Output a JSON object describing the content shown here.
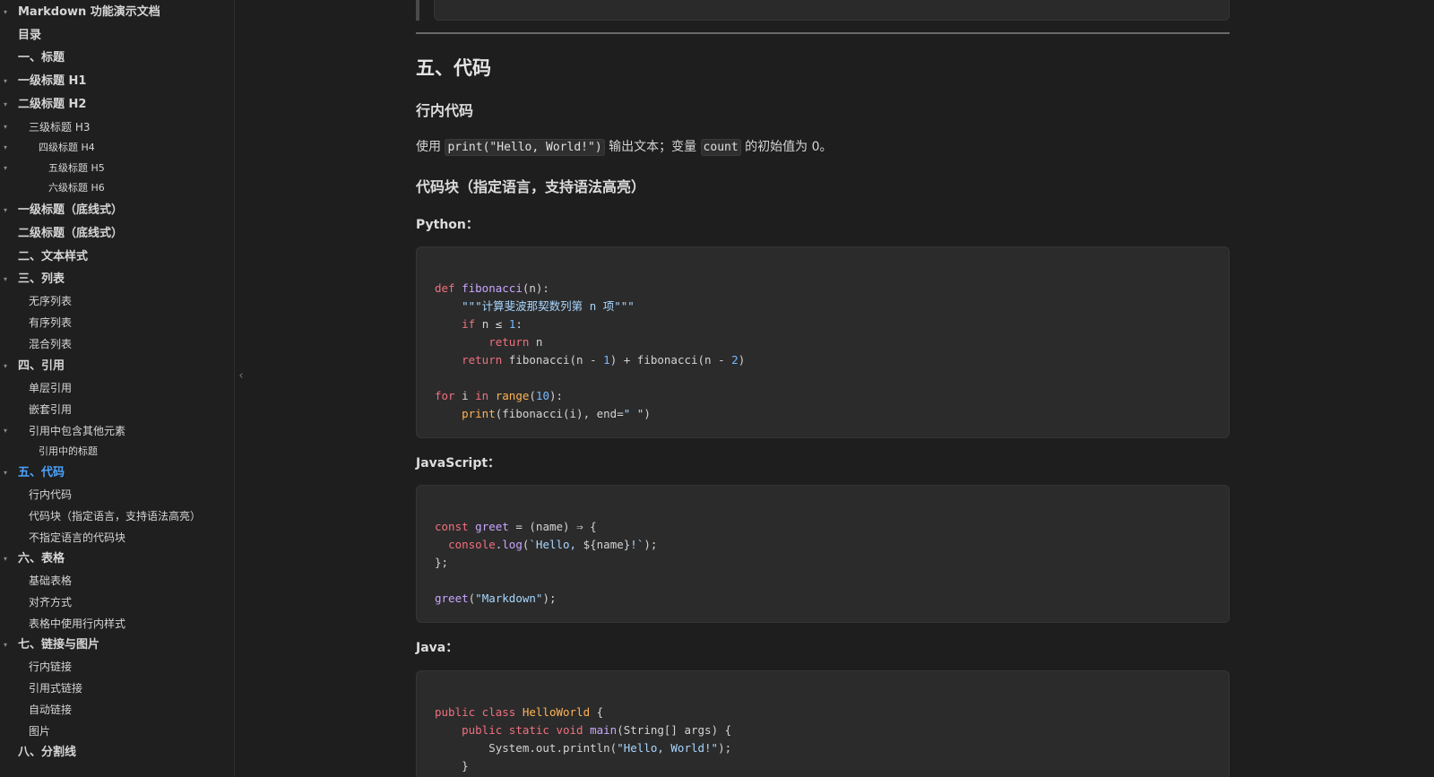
{
  "sidebar": {
    "items": [
      {
        "label": "Markdown 功能演示文档",
        "level": 1,
        "arrow": true,
        "active": false
      },
      {
        "label": "目录",
        "level": 1,
        "arrow": false,
        "active": false
      },
      {
        "label": "一、标题",
        "level": 1,
        "arrow": false,
        "active": false
      },
      {
        "label": "一级标题 H1",
        "level": 1,
        "arrow": true,
        "active": false
      },
      {
        "label": "二级标题 H2",
        "level": 1,
        "arrow": true,
        "active": false
      },
      {
        "label": "三级标题 H3",
        "level": 2,
        "arrow": true,
        "active": false
      },
      {
        "label": "四级标题 H4",
        "level": 3,
        "arrow": true,
        "active": false
      },
      {
        "label": "五级标题 H5",
        "level": 4,
        "arrow": true,
        "active": false
      },
      {
        "label": "六级标题 H6",
        "level": 4,
        "arrow": false,
        "active": false
      },
      {
        "label": "一级标题（底线式）",
        "level": 1,
        "arrow": true,
        "active": false
      },
      {
        "label": "二级标题（底线式）",
        "level": 1,
        "arrow": false,
        "active": false
      },
      {
        "label": "二、文本样式",
        "level": 1,
        "arrow": false,
        "active": false
      },
      {
        "label": "三、列表",
        "level": 1,
        "arrow": true,
        "active": false
      },
      {
        "label": "无序列表",
        "level": 2,
        "arrow": false,
        "active": false
      },
      {
        "label": "有序列表",
        "level": 2,
        "arrow": false,
        "active": false
      },
      {
        "label": "混合列表",
        "level": 2,
        "arrow": false,
        "active": false
      },
      {
        "label": "四、引用",
        "level": 1,
        "arrow": true,
        "active": false
      },
      {
        "label": "单层引用",
        "level": 2,
        "arrow": false,
        "active": false
      },
      {
        "label": "嵌套引用",
        "level": 2,
        "arrow": false,
        "active": false
      },
      {
        "label": "引用中包含其他元素",
        "level": 2,
        "arrow": true,
        "active": false
      },
      {
        "label": "引用中的标题",
        "level": 3,
        "arrow": false,
        "active": false
      },
      {
        "label": "五、代码",
        "level": 1,
        "arrow": true,
        "active": true
      },
      {
        "label": "行内代码",
        "level": 2,
        "arrow": false,
        "active": false
      },
      {
        "label": "代码块（指定语言，支持语法高亮）",
        "level": 2,
        "arrow": false,
        "active": false
      },
      {
        "label": "不指定语言的代码块",
        "level": 2,
        "arrow": false,
        "active": false
      },
      {
        "label": "六、表格",
        "level": 1,
        "arrow": true,
        "active": false
      },
      {
        "label": "基础表格",
        "level": 2,
        "arrow": false,
        "active": false
      },
      {
        "label": "对齐方式",
        "level": 2,
        "arrow": false,
        "active": false
      },
      {
        "label": "表格中使用行内样式",
        "level": 2,
        "arrow": false,
        "active": false
      },
      {
        "label": "七、链接与图片",
        "level": 1,
        "arrow": true,
        "active": false
      },
      {
        "label": "行内链接",
        "level": 2,
        "arrow": false,
        "active": false
      },
      {
        "label": "引用式链接",
        "level": 2,
        "arrow": false,
        "active": false
      },
      {
        "label": "自动链接",
        "level": 2,
        "arrow": false,
        "active": false
      },
      {
        "label": "图片",
        "level": 2,
        "arrow": false,
        "active": false
      },
      {
        "label": "八、分割线",
        "level": 1,
        "arrow": false,
        "active": false
      }
    ],
    "collapse_glyph": "‹",
    "arrow_glyph": "▾"
  },
  "content": {
    "section_title": "五、代码",
    "inline_code": {
      "heading": "行内代码",
      "text_before": "使用",
      "code1": "print(\"Hello, World!\")",
      "text_middle": "输出文本；变量",
      "code2": "count",
      "text_after": "的初始值为 0。"
    },
    "code_blocks_heading": "代码块（指定语言，支持语法高亮）",
    "python": {
      "label": "Python：",
      "lines": [
        [],
        [
          {
            "t": "def ",
            "c": "kw"
          },
          {
            "t": "fibonacci",
            "c": "fn"
          },
          {
            "t": "(n):",
            "c": "plain"
          }
        ],
        [
          {
            "t": "    \"\"\"计算斐波那契数列第 n 项\"\"\"",
            "c": "str"
          }
        ],
        [
          {
            "t": "    ",
            "c": "plain"
          },
          {
            "t": "if",
            "c": "kw"
          },
          {
            "t": " n ≤ ",
            "c": "plain"
          },
          {
            "t": "1",
            "c": "num"
          },
          {
            "t": ":",
            "c": "plain"
          }
        ],
        [
          {
            "t": "        ",
            "c": "plain"
          },
          {
            "t": "return",
            "c": "kw"
          },
          {
            "t": " n",
            "c": "plain"
          }
        ],
        [
          {
            "t": "    ",
            "c": "plain"
          },
          {
            "t": "return",
            "c": "kw"
          },
          {
            "t": " fibonacci(n - ",
            "c": "plain"
          },
          {
            "t": "1",
            "c": "num"
          },
          {
            "t": ") + fibonacci(n - ",
            "c": "plain"
          },
          {
            "t": "2",
            "c": "num"
          },
          {
            "t": ")",
            "c": "plain"
          }
        ],
        [],
        [
          {
            "t": "for",
            "c": "kw"
          },
          {
            "t": " i ",
            "c": "plain"
          },
          {
            "t": "in",
            "c": "kw"
          },
          {
            "t": " ",
            "c": "plain"
          },
          {
            "t": "range",
            "c": "bi"
          },
          {
            "t": "(",
            "c": "plain"
          },
          {
            "t": "10",
            "c": "num"
          },
          {
            "t": "):",
            "c": "plain"
          }
        ],
        [
          {
            "t": "    ",
            "c": "plain"
          },
          {
            "t": "print",
            "c": "bi"
          },
          {
            "t": "(fibonacci(i), end=",
            "c": "plain"
          },
          {
            "t": "\" \"",
            "c": "str"
          },
          {
            "t": ")",
            "c": "plain"
          }
        ]
      ]
    },
    "javascript": {
      "label": "JavaScript：",
      "lines": [
        [],
        [
          {
            "t": "const",
            "c": "kw"
          },
          {
            "t": " ",
            "c": "plain"
          },
          {
            "t": "greet",
            "c": "fn"
          },
          {
            "t": " = (name) ⇒ {",
            "c": "plain"
          }
        ],
        [
          {
            "t": "  ",
            "c": "plain"
          },
          {
            "t": "console",
            "c": "kw"
          },
          {
            "t": ".",
            "c": "plain"
          },
          {
            "t": "log",
            "c": "fn"
          },
          {
            "t": "(",
            "c": "plain"
          },
          {
            "t": "`Hello, ",
            "c": "str"
          },
          {
            "t": "${name}",
            "c": "plain"
          },
          {
            "t": "!`",
            "c": "str"
          },
          {
            "t": ");",
            "c": "plain"
          }
        ],
        [
          {
            "t": "};",
            "c": "plain"
          }
        ],
        [],
        [
          {
            "t": "greet",
            "c": "fn"
          },
          {
            "t": "(",
            "c": "plain"
          },
          {
            "t": "\"Markdown\"",
            "c": "str"
          },
          {
            "t": ");",
            "c": "plain"
          }
        ]
      ]
    },
    "java": {
      "label": "Java：",
      "lines": [
        [],
        [
          {
            "t": "public class ",
            "c": "kw"
          },
          {
            "t": "HelloWorld",
            "c": "bi"
          },
          {
            "t": " {",
            "c": "plain"
          }
        ],
        [
          {
            "t": "    ",
            "c": "plain"
          },
          {
            "t": "public static void ",
            "c": "kw"
          },
          {
            "t": "main",
            "c": "fn"
          },
          {
            "t": "(String[] args) {",
            "c": "plain"
          }
        ],
        [
          {
            "t": "        System.out.println(",
            "c": "plain"
          },
          {
            "t": "\"Hello, World!\"",
            "c": "str"
          },
          {
            "t": ");",
            "c": "plain"
          }
        ],
        [
          {
            "t": "    }",
            "c": "plain"
          }
        ]
      ]
    }
  },
  "colors": {
    "background": "#1e1e1e",
    "active_outline": "#4aa3ff",
    "keyword": "#f0707e",
    "function": "#c9a6ff",
    "string": "#a8d6ff",
    "number": "#79b8ff",
    "builtin": "#ffb454"
  }
}
